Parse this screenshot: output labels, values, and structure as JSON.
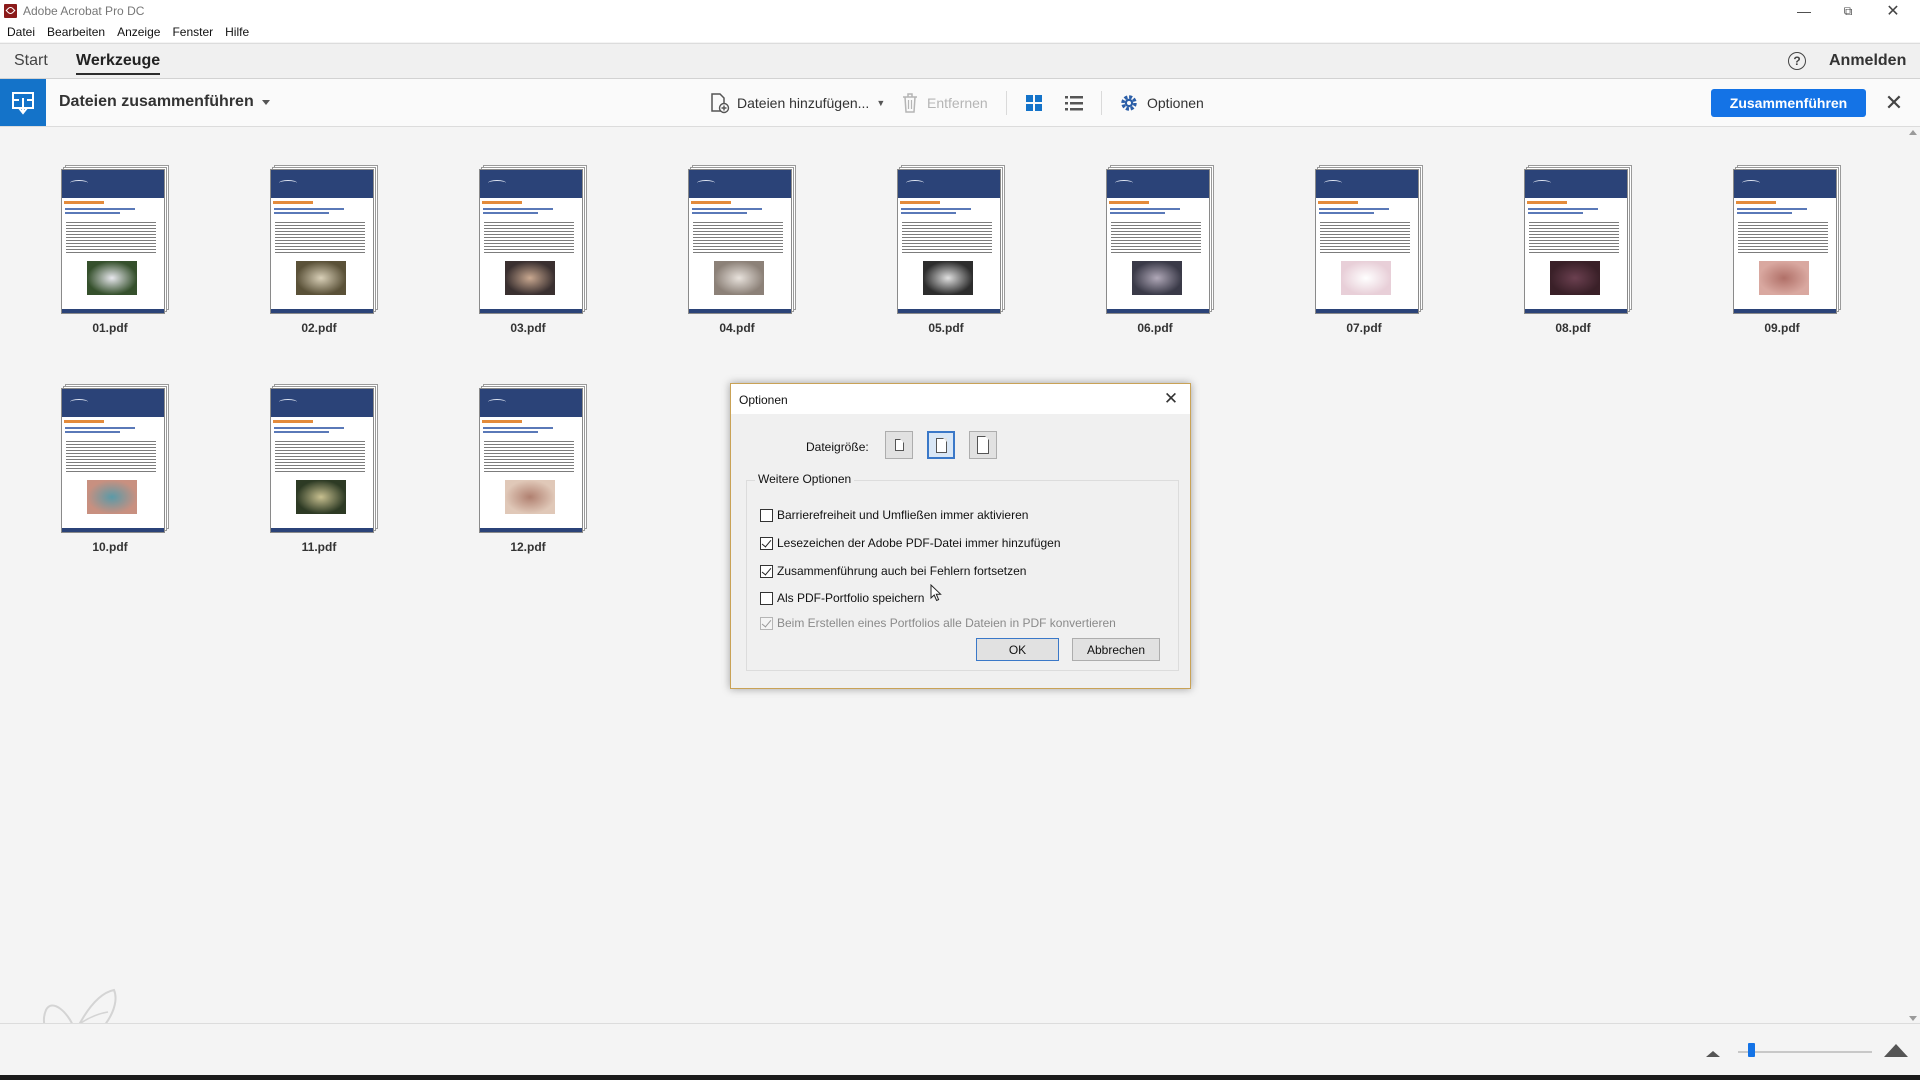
{
  "window": {
    "title": "Adobe Acrobat Pro DC"
  },
  "menu": {
    "items": [
      "Datei",
      "Bearbeiten",
      "Anzeige",
      "Fenster",
      "Hilfe"
    ]
  },
  "nav": {
    "tab_start": "Start",
    "tab_tools": "Werkzeuge",
    "help": "?",
    "signin": "Anmelden"
  },
  "tool": {
    "title": "Dateien zusammenführen",
    "add_files": "Dateien hinzufügen...",
    "remove": "Entfernen",
    "options": "Optionen",
    "merge": "Zusammenführen",
    "accent": "#1473e6"
  },
  "files": [
    {
      "name": "01.pdf",
      "photo_colors": [
        "#35502c",
        "#e8e8ee"
      ]
    },
    {
      "name": "02.pdf",
      "photo_colors": [
        "#5a5138",
        "#d9d0b8"
      ]
    },
    {
      "name": "03.pdf",
      "photo_colors": [
        "#3a3030",
        "#c9a890"
      ]
    },
    {
      "name": "04.pdf",
      "photo_colors": [
        "#8c8178",
        "#e8e2dc"
      ]
    },
    {
      "name": "05.pdf",
      "photo_colors": [
        "#2d2d2d",
        "#e0e0e0"
      ]
    },
    {
      "name": "06.pdf",
      "photo_colors": [
        "#3a3a48",
        "#b0a8b8"
      ]
    },
    {
      "name": "07.pdf",
      "photo_colors": [
        "#e8cfd8",
        "#ffffff"
      ]
    },
    {
      "name": "08.pdf",
      "photo_colors": [
        "#3a2028",
        "#6b4050"
      ]
    },
    {
      "name": "09.pdf",
      "photo_colors": [
        "#d9a8a0",
        "#b07068"
      ]
    },
    {
      "name": "10.pdf",
      "photo_colors": [
        "#c89080",
        "#5a9aa8"
      ]
    },
    {
      "name": "11.pdf",
      "photo_colors": [
        "#2d3a24",
        "#c8c090"
      ]
    },
    {
      "name": "12.pdf",
      "photo_colors": [
        "#e0c8b8",
        "#b08070"
      ]
    }
  ],
  "dialog": {
    "title": "Optionen",
    "size_label": "Dateigröße:",
    "size_selected": "medium",
    "group_label": "Weitere Optionen",
    "options": [
      {
        "label": "Barrierefreiheit und Umfließen immer aktivieren",
        "checked": false,
        "disabled": false
      },
      {
        "label": "Lesezeichen der Adobe PDF-Datei immer hinzufügen",
        "checked": true,
        "disabled": false
      },
      {
        "label": "Zusammenführung auch bei Fehlern fortsetzen",
        "checked": true,
        "disabled": false
      },
      {
        "label": "Als PDF-Portfolio speichern",
        "checked": false,
        "disabled": false
      },
      {
        "label": "Beim Erstellen eines Portfolios alle Dateien in PDF konvertieren",
        "checked": true,
        "disabled": true
      }
    ],
    "ok": "OK",
    "cancel": "Abbrechen"
  },
  "zoom": {
    "value": 0.1
  }
}
